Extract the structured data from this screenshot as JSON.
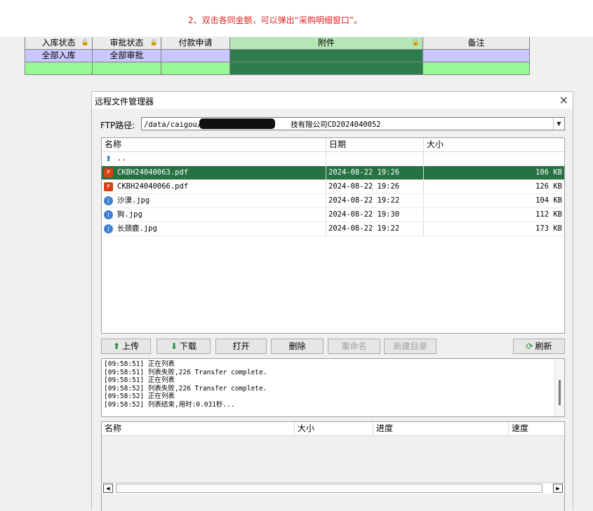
{
  "hint": "2、双击各同金额，可以弹出“采购明细窗口”。",
  "grid": {
    "headers": [
      "入库状态",
      "审批状态",
      "付款申请",
      "附件",
      "备注"
    ],
    "row1": [
      "全部入库",
      "全部审批",
      "",
      "",
      ""
    ]
  },
  "dialog": {
    "title": "远程文件管理器",
    "close": "×",
    "ftp_label": "FTP路径:",
    "ftp_path_prefix": "/data/caigou/安徽",
    "ftp_path_suffix": "技有限公司CD2024040052",
    "columns": {
      "name": "名称",
      "date": "日期",
      "size": "大小"
    },
    "files": [
      {
        "name": "..",
        "date": "",
        "size": "",
        "icon": "up-arrow-icon"
      },
      {
        "name": "CKBH24040063.pdf",
        "date": "2024-08-22 19:26",
        "size": "106 KB",
        "icon": "pdf-icon"
      },
      {
        "name": "CKBH24040066.pdf",
        "date": "2024-08-22 19:26",
        "size": "126 KB",
        "icon": "pdf-icon"
      },
      {
        "name": "沙漠.jpg",
        "date": "2024-08-22 19:22",
        "size": "104 KB",
        "icon": "jpg-icon"
      },
      {
        "name": "狗.jpg",
        "date": "2024-08-22 19:30",
        "size": "112 KB",
        "icon": "jpg-icon"
      },
      {
        "name": "长颈鹿.jpg",
        "date": "2024-08-22 19:22",
        "size": "173 KB",
        "icon": "jpg-icon"
      }
    ],
    "buttons": {
      "upload": "上传",
      "download": "下载",
      "open": "打开",
      "delete": "删除",
      "rename": "重命名",
      "mkdir": "新建目录",
      "refresh": "刷新"
    },
    "log": [
      "[09:58:51] 正在列表",
      "[09:58:51] 列表失败,226 Transfer complete.",
      "[09:58:51] 正在列表",
      "[09:58:52] 列表失败,226 Transfer complete.",
      "[09:58:52] 正在列表",
      "[09:58:52] 列表结束,用时:0.031秒..."
    ],
    "transfer_columns": {
      "name": "名称",
      "size": "大小",
      "progress": "进度",
      "speed": "速度"
    }
  },
  "colors": {
    "selected_row": "#267243",
    "attachment_column": "#2e7d4e",
    "hint_text": "#e02020"
  }
}
